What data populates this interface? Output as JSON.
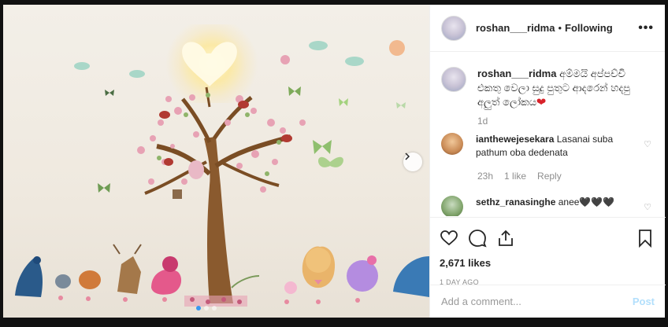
{
  "post": {
    "author": "roshan___ridma",
    "separator": "•",
    "follow_status": "Following",
    "more_label": "•••",
    "caption": "අම්මයි අප්පච්චි එකතු වෙලා සුදු පුතුට ආදරෙන් හදපු අලුත් ලෝකය",
    "caption_emoji": "❤",
    "caption_time": "1d",
    "comments": [
      {
        "user": "ianthewejesekara",
        "text": "Lasanai suba pathum oba dedenata",
        "time": "23h",
        "likes": "1 like",
        "reply": "Reply"
      },
      {
        "user": "sethz_ranasinghe",
        "text": "anee🖤🖤🖤",
        "time": "",
        "likes": "",
        "reply": ""
      }
    ],
    "likes_count": "2,671 likes",
    "time_ago": "1 DAY AGO",
    "comment_placeholder": "Add a comment...",
    "post_label": "Post"
  },
  "icons": {
    "like": "heart-icon",
    "comment": "comment-icon",
    "share": "share-icon",
    "save": "bookmark-icon",
    "next": "chevron-right-icon"
  },
  "colors": {
    "link_blue": "#3897f0",
    "post_disabled": "#b2dffc",
    "muted": "#8e8e8e",
    "text": "#262626",
    "heart_red": "#d8222a"
  }
}
